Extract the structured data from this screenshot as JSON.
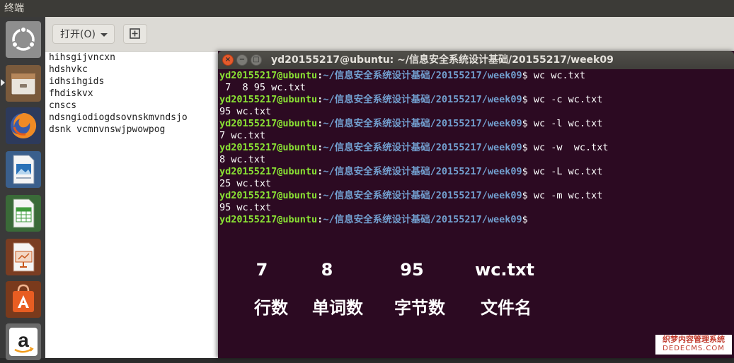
{
  "top_panel": {
    "title": "终端"
  },
  "launcher": {
    "items": [
      {
        "name": "dash-icon",
        "color": "#7a7a7a"
      },
      {
        "name": "files-icon",
        "color": "#b06030"
      },
      {
        "name": "firefox-icon",
        "color": "#e8662d"
      },
      {
        "name": "impress-document-icon",
        "color": "#2a72b8"
      },
      {
        "name": "calc-spreadsheet-icon",
        "color": "#3f9b3c"
      },
      {
        "name": "impress-presentation-icon",
        "color": "#c8581e"
      },
      {
        "name": "software-center-icon",
        "color": "#e85d22"
      },
      {
        "name": "amazon-icon",
        "color": "#3b3b3b"
      }
    ]
  },
  "editor": {
    "open_label": "打开(O)",
    "lines": [
      "hihsgijvncxn",
      "hdshvkc",
      "idhsihgids",
      "fhdiskvx",
      "cnscs",
      "ndsngiodiogdsovnskmvndsjo",
      "dsnk vcmnvnswjpwowpog"
    ]
  },
  "terminal": {
    "title": "yd20155217@ubuntu: ~/信息安全系统设计基础/20155217/week09",
    "prompt_user": "yd20155217@ubuntu",
    "prompt_colon": ":",
    "prompt_path": "~/信息安全系统设计基础/20155217/week09",
    "prompt_dollar": "$",
    "lines": [
      {
        "type": "cmd",
        "text": " wc wc.txt"
      },
      {
        "type": "out",
        "text": " 7  8 95 wc.txt"
      },
      {
        "type": "cmd",
        "text": " wc -c wc.txt"
      },
      {
        "type": "out",
        "text": "95 wc.txt"
      },
      {
        "type": "cmd",
        "text": " wc -l wc.txt"
      },
      {
        "type": "out",
        "text": "7 wc.txt"
      },
      {
        "type": "cmd",
        "text": " wc -w  wc.txt"
      },
      {
        "type": "out",
        "text": "8 wc.txt"
      },
      {
        "type": "cmd",
        "text": " wc -L wc.txt"
      },
      {
        "type": "out",
        "text": "25 wc.txt"
      },
      {
        "type": "cmd",
        "text": " wc -m wc.txt"
      },
      {
        "type": "out",
        "text": "95 wc.txt"
      },
      {
        "type": "cmd",
        "text": ""
      }
    ]
  },
  "annotation": {
    "values": [
      "7",
      "8",
      "95",
      "wc.txt"
    ],
    "labels": [
      "行数",
      "单词数",
      "字节数",
      "文件名"
    ]
  },
  "watermark": {
    "line1": "织梦内容管理系统",
    "line2": "DEDECMS.COM"
  },
  "colors": {
    "prompt_user": "#8ae234",
    "prompt_path": "#729fcf",
    "terminal_bg": "#2c0a22"
  }
}
